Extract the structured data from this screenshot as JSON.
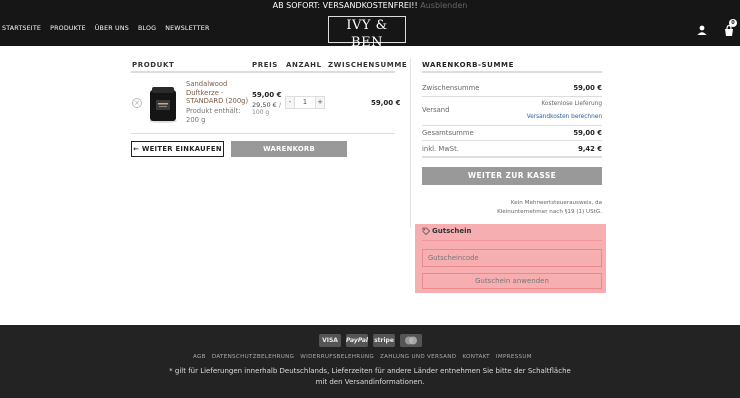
{
  "announcement": {
    "text": "AB SOFORT: VERSANDKOSTENFREI!! ",
    "dismiss": "Ausblenden"
  },
  "nav": [
    "STARTSEITE",
    "PRODUKTE",
    "ÜBER UNS",
    "BLOG",
    "NEWSLETTER"
  ],
  "logo": {
    "name": "IVY & BEN",
    "sub": "NEW YORK"
  },
  "cart": {
    "count": "0"
  },
  "table": {
    "headers": {
      "product": "PRODUKT",
      "price": "PREIS",
      "qty": "ANZAHL",
      "subtotal": "ZWISCHENSUMME"
    }
  },
  "item": {
    "remove": "×",
    "name": "Sandalwood Duftkerze - STANDARD (200g)",
    "meta": "Produkt enthält: 200 g",
    "price": "59,00 €",
    "unit_price": "29,50 €",
    "unit_sep": " /",
    "unit": "100 g",
    "qty": "1",
    "minus": "-",
    "plus": "+",
    "subtotal": "59,00 €"
  },
  "buttons": {
    "continue": "← WEITER EINKAUFEN",
    "update": "WARENKORB AKTUALISIEREN"
  },
  "summary": {
    "title": "WARENKORB-SUMME",
    "subtotal_label": "Zwischensumme",
    "subtotal": "59,00 €",
    "shipping_label": "Versand",
    "shipping_value": "Kostenlose Lieferung",
    "shipping_link": "Versandkosten berechnen",
    "total_label": "Gesamtsumme",
    "total": "59,00 €",
    "vat_label": "inkl. MwSt.",
    "vat": "9,42 €",
    "checkout": "WEITER ZUR KASSE",
    "note": "Kein Mehrwertsteuerausweis, da Kleinunternehmer nach §19 (1) UStG."
  },
  "coupon": {
    "title": "Gutschein",
    "placeholder": "Gutscheincode",
    "button": "Gutschein anwenden"
  },
  "footer": {
    "payments": [
      "VISA",
      "PayPal",
      "stripe",
      "MC"
    ],
    "links": [
      "AGB",
      "DATENSCHUTZBELEHRUNG",
      "WIDERRUFSBELEHRUNG",
      "ZAHLUNG UND VERSAND",
      "KONTAKT",
      "IMPRESSUM"
    ],
    "note": "* gilt für Lieferungen innerhalb Deutschlands, Lieferzeiten für andere Länder entnehmen Sie bitte der Schaltfläche mit den Versandinformationen."
  },
  "colors": {
    "header": "#161616",
    "product_link": "#7a5a46",
    "coupon_highlight": "#f6aeb1",
    "button_grey": "#999999"
  }
}
